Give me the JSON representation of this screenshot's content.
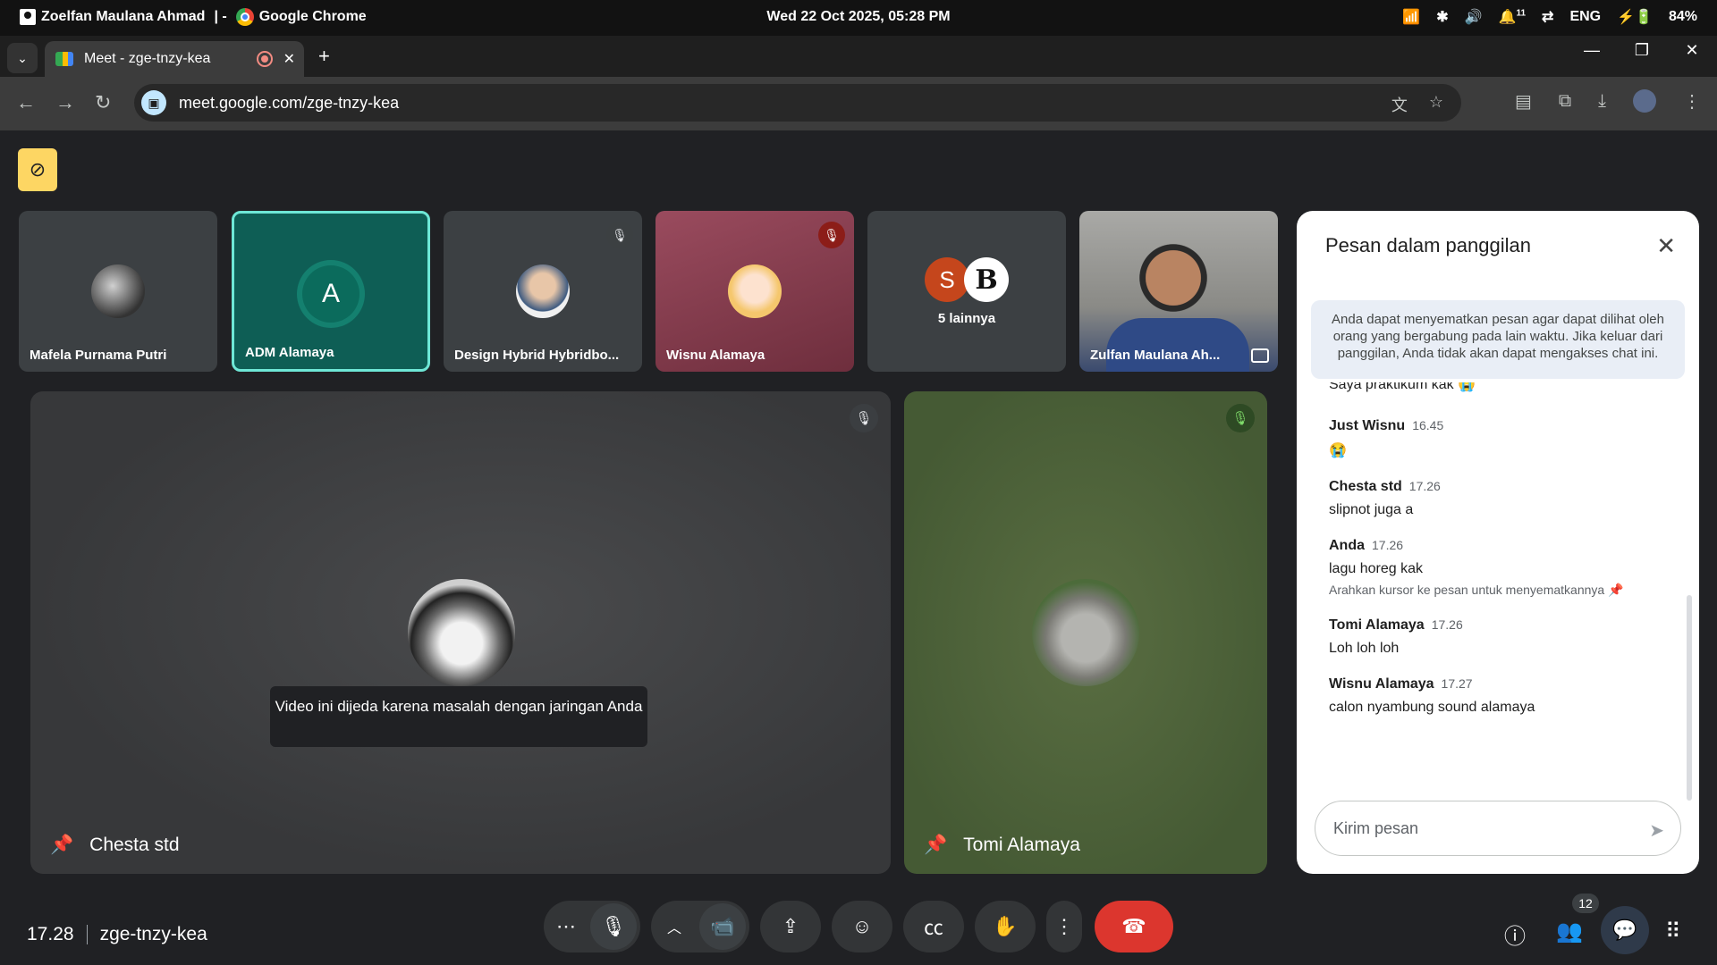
{
  "os": {
    "user": "Zoelfan Maulana Ahmad",
    "separator": "|  -",
    "app": "Google Chrome",
    "datetime": "Wed 22 Oct 2025, 05:28 PM",
    "lang": "ENG",
    "battery": "84%",
    "notif_count": "11"
  },
  "browser": {
    "tab_title": "Meet - zge-tnzy-kea",
    "url": "meet.google.com/zge-tnzy-kea"
  },
  "tiles": [
    {
      "name": "Mafela Purnama Putri"
    },
    {
      "name": "ADM Alamaya",
      "letter": "A"
    },
    {
      "name": "Design Hybrid Hybridbo..."
    },
    {
      "name": "Wisnu Alamaya"
    },
    {
      "name": "5 lainnya",
      "s_letter": "S",
      "b_letter": "B"
    },
    {
      "name": "Zulfan Maulana Ah..."
    }
  ],
  "main": {
    "left_name": "Chesta std",
    "right_name": "Tomi Alamaya",
    "paused_notice": "Video ini dijeda karena masalah dengan jaringan Anda"
  },
  "chat": {
    "title": "Pesan dalam panggilan",
    "info": "Anda dapat menyematkan pesan agar dapat dilihat oleh orang yang bergabung pada lain waktu. Jika keluar dari panggilan, Anda tidak akan dapat mengakses chat ini.",
    "partial": "Saya praktikum kak 😭",
    "messages": [
      {
        "who": "Just Wisnu",
        "time": "16.45",
        "text": "😭"
      },
      {
        "who": "Chesta std",
        "time": "17.26",
        "text": "slipnot juga a"
      },
      {
        "who": "Anda",
        "time": "17.26",
        "text": "lagu horeg kak",
        "hint": "Arahkan kursor ke pesan untuk menyematkannya 📌"
      },
      {
        "who": "Tomi Alamaya",
        "time": "17.26",
        "text": "Loh loh loh"
      },
      {
        "who": "Wisnu Alamaya",
        "time": "17.27",
        "text": "calon nyambung sound alamaya"
      }
    ],
    "placeholder": "Kirim pesan"
  },
  "bottom": {
    "time": "17.28",
    "code": "zge-tnzy-kea",
    "people_count": "12"
  }
}
